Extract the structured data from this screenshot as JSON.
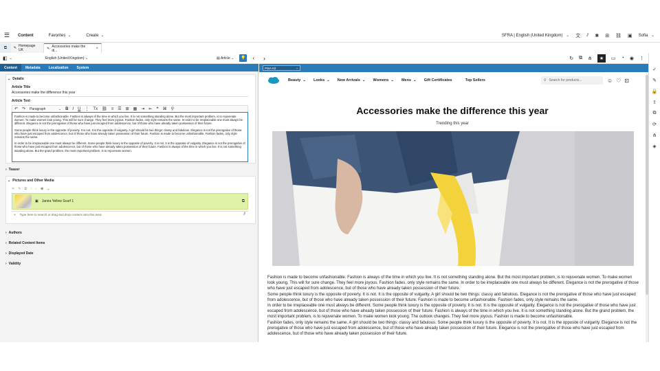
{
  "topbar": {
    "title": "Content",
    "favorites": "Favorites",
    "create": "Create",
    "site": "SFRA | English (United Kingdom)",
    "user": "Sofia"
  },
  "tabs": {
    "home": "Homepage UK",
    "article": "Accessories make the di..."
  },
  "form_toolbar": {
    "locale": "English (United Kingdom)",
    "type": "Article"
  },
  "form_tabs": [
    "Content",
    "Metadata",
    "Localization",
    "System"
  ],
  "details": {
    "heading": "Details",
    "title_label": "Article Title",
    "title_value": "Accessories make the difference this year",
    "text_label": "Article Text",
    "paragraph_style": "Paragraph",
    "rt_paragraphs": [
      "Fashion is made to become unfashionable. Fashion is always of the time in which you live. It is not something standing alone. But the most important problem, is to rejuvenate women. To make women look young. This will for sure change. They feel more joyous. Fashion fades, only style remains the same. In order to be irreplaceable one must always be different. Elegance is not the prerogative of those who have just escaped from adolescence, but of those who have already taken possession of their future.",
      "Some people think luxury is the opposite of poverty. It is not. It is the opposite of vulgarity. A girl should be two things: classy and fabulous. Elegance is not the prerogative of those who have just escaped from adolescence, but of those who have already taken possession of their future. Fashion is made to become unfashionable. Fashion fades, only style remains the same.",
      "In order to be irreplaceable one must always be different. Some people think luxury is the opposite of poverty. It is not. It is the opposite of vulgarity. Elegance is not the prerogative of those who have just escaped from adolescence, but of those who have already taken possession of their future. Fashion is always of the time in which you live. It is not something standing alone. But the grand problem, the most important problem, is to rejuvenate women."
    ]
  },
  "sections": {
    "teaser": "Teaser",
    "pictures": "Pictures and Other Media",
    "authors": "Authors",
    "related": "Related Content Items",
    "displayed_date": "Displayed Date",
    "validity": "Validity"
  },
  "media": {
    "item_name": "Janira Yellow Scarf 1",
    "search_placeholder": "Type here to search or drag and drop content onto this area."
  },
  "preview": {
    "site_select": "PWA Kit",
    "nav": [
      "Beauty",
      "Looks",
      "New Arrivals",
      "Womens",
      "Mens",
      "Gift Certificates",
      "Top Sellers"
    ],
    "search_placeholder": "Search for products...",
    "article_title": "Accessories make the difference this year",
    "article_subtitle": "Trending this year",
    "body_paragraphs": [
      "Fashion is made to become unfashionable. Fashion is always of the time in which you live. It is not something standing alone. But the most important problem, is to rejuvenate women. To make women look young. This will for sure change. They feel more joyous. Fashion fades, only style remains the same. In order to be irreplaceable one must always be different. Elegance is not the prerogative of those who have just escaped from adolescence, but of those who have already taken possession of their future.",
      "Some people think luxury is the opposite of poverty. It is not. It is the opposite of vulgarity. A girl should be two things: classy and fabulous. Elegance is not the prerogative of those who have just escaped from adolescence, but of those who have already taken possession of their future. Fashion is made to become unfashionable. Fashion fades, only style remains the same.",
      "In order to be irreplaceable one must always be different. Some people think luxury is the opposite of poverty. It is not. It is the opposite of vulgarity. Elegance is not the prerogative of those who have just escaped from adolescence, but of those who have already taken possession of their future. Fashion is always of the time in which you live. It is not something standing alone. But the grand problem, the most important problem, is to rejuvenate women. To make women look young. The outlook changes. They feel more joyous. Fashion is made to become unfashionable.",
      "Fashion fades, only style remains the same. A girl should be two things: classy and fabulous. Some people think luxury is the opposite of poverty. It is not. It is the opposite of vulgarity. Elegance is not the prerogative of those who have just escaped from adolescence, but of those who have already taken possession of their future. Elegance is not the prerogative of those who have just escaped from adolescence, but of those who have already taken possession of their future."
    ]
  },
  "colors": {
    "accent": "#2b7bb9",
    "media_highlight": "#dff2a8",
    "scarf_yellow": "#f3d23c"
  }
}
